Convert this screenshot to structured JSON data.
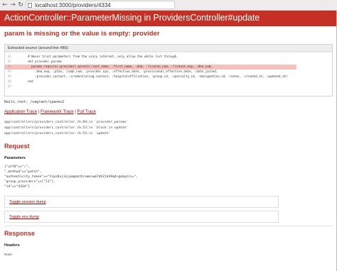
{
  "browser": {
    "url": "localhost:3000/providers/4334",
    "back_glyph": "←",
    "forward_glyph": "→",
    "reload_glyph": "↻"
  },
  "header": {
    "title": "ActionController::ParameterMissing in ProvidersController#update"
  },
  "error": {
    "message": "param is missing or the value is empty: provider"
  },
  "source": {
    "header": "Extracted source (around line #86):",
    "lines": [
      {
        "num": "81",
        "code": "    # Never trust parameters from the scary internet, only allow the white list through."
      },
      {
        "num": "82",
        "code": "    def provider_params"
      },
      {
        "num": "83",
        "code": "      params.require(:provider).permit(:last_name, :first_name, :dob, :license_num, :license_exp, :dea_num,"
      },
      {
        "num": "84",
        "code": "        :dea_exp, :ptan, :caqh_num, :provider_npi, :effective_date, :provisional_effective_date, :date_joined,"
      },
      {
        "num": "85",
        "code": "        :provider_contact, :credentialing_contact, :hospitalaffiliation, :group_id, :specialty_id, :designation_id, :notes, :created_at, :updated_at)"
      },
      {
        "num": "86",
        "code": "    end"
      },
      {
        "num": "87",
        "code": ""
      }
    ]
  },
  "rails_root": "Rails.root: /vagrant/ipanev2",
  "trace": {
    "application": "Application Trace",
    "framework": "Framework Trace",
    "full": "Full Trace",
    "sep1": " | ",
    "sep2": " | ",
    "lines": [
      "app/controllers/providers_controller.rb:84:in `provider_params'",
      "app/controllers/providers_controller.rb:53:in `block in update'",
      "app/controllers/providers_controller.rb:52:in `update'"
    ]
  },
  "request": {
    "title": "Request",
    "params_title": "Parameters",
    "params_lines": [
      "{\"utf8\"=>\"✓\",",
      " \"_method\"=>\"patch\",",
      " \"authenticity_token\"=>\"t3ys0vjikjymgmoth/umeiwm7dh2jkh9q4+gokpzis=\",",
      " \"group_providers\"=>[\"11\"],",
      " \"id\"=>\"4334\"}"
    ],
    "toggle_session": "Toggle session dump",
    "toggle_env": "Toggle env dump"
  },
  "response": {
    "title": "Response",
    "headers_title": "Headers",
    "headers_value": "None"
  }
}
